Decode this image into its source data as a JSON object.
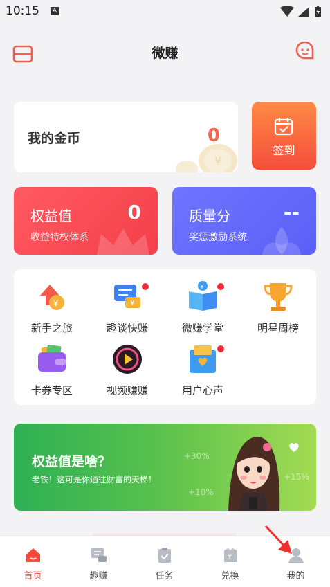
{
  "status": {
    "time": "10:15",
    "notif": "A"
  },
  "header": {
    "title": "微赚"
  },
  "coins": {
    "label": "我的金币",
    "value": "0"
  },
  "signin": {
    "label": "签到"
  },
  "rights": {
    "name": "权益值",
    "value": "0",
    "sub": "收益特权体系"
  },
  "quality": {
    "name": "质量分",
    "value": "--",
    "sub": "奖惩激励系统"
  },
  "features": [
    {
      "label": "新手之旅",
      "icon": "arrow-coin-icon",
      "dot": false
    },
    {
      "label": "趣谈快赚",
      "icon": "chat-coin-icon",
      "dot": true
    },
    {
      "label": "微赚学堂",
      "icon": "book-icon",
      "dot": true
    },
    {
      "label": "明星周榜",
      "icon": "trophy-icon",
      "dot": false
    },
    {
      "label": "卡券专区",
      "icon": "wallet-icon",
      "dot": false
    },
    {
      "label": "视频赚赚",
      "icon": "video-play-icon",
      "dot": false
    },
    {
      "label": "用户心声",
      "icon": "heart-mailbox-icon",
      "dot": true
    }
  ],
  "banner": {
    "headline": "权益值是啥？",
    "sub": "老铁！这可是你通往财富的天梯！",
    "pct1": "+30%",
    "pct2": "+10%",
    "pct3": "+15%"
  },
  "nav": [
    {
      "label": "首页",
      "icon": "home-icon",
      "active": true
    },
    {
      "label": "趣赚",
      "icon": "chat-icon",
      "active": false
    },
    {
      "label": "任务",
      "icon": "clipboard-icon",
      "active": false
    },
    {
      "label": "兑换",
      "icon": "exchange-icon",
      "active": false
    },
    {
      "label": "我的",
      "icon": "user-icon",
      "active": false
    }
  ],
  "colors": {
    "accent": "#f24b3d",
    "rights_card": "#f6434d",
    "quality_card": "#6368fb",
    "banner": "#3fb650"
  }
}
